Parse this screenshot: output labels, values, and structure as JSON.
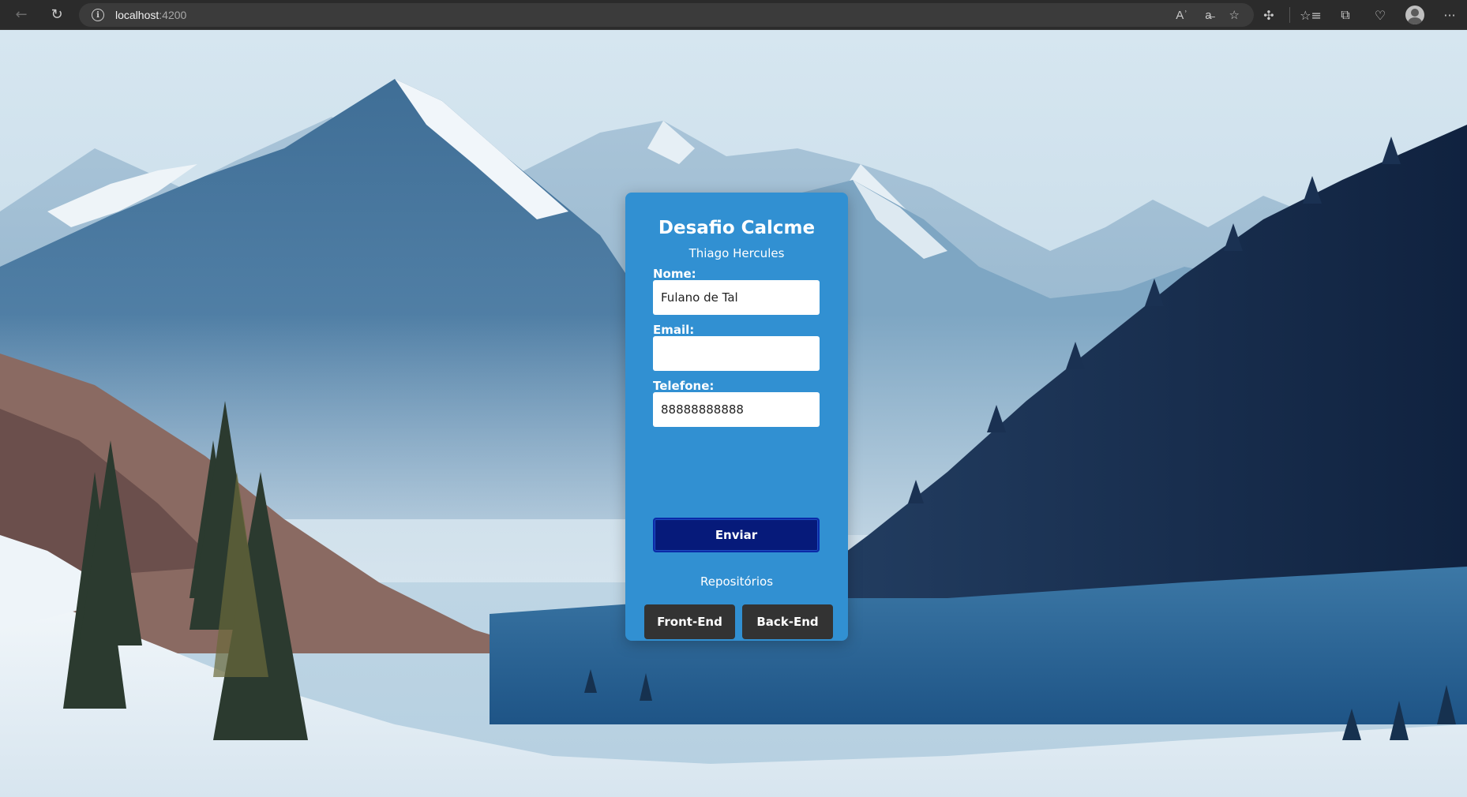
{
  "browser": {
    "url_host": "localhost",
    "url_port": ":4200",
    "icons": [
      "back-icon",
      "refresh-icon",
      "info-icon",
      "read-aloud-icon",
      "translate-icon",
      "favorite-star-icon",
      "extensions-icon",
      "favorites-icon",
      "collections-icon",
      "browser-essentials-icon",
      "profile-icon",
      "more-icon"
    ],
    "glyphs": {
      "back": "←",
      "refresh": "↻",
      "info": "i",
      "read_aloud": "Aʾ",
      "translate": "a̶",
      "star": "☆",
      "extensions": "✣",
      "favorites": "☆≡",
      "collections": "⧉",
      "essentials": "♡",
      "more": "···"
    }
  },
  "form": {
    "title": "Desafio Calcme",
    "subtitle": "Thiago Hercules",
    "name_label": "Nome:",
    "name_value": "Fulano de Tal",
    "email_label": "Email:",
    "email_value": "",
    "phone_label": "Telefone:",
    "phone_value": "88888888888",
    "submit_label": "Enviar",
    "repos_label": "Repositórios",
    "frontend_label": "Front-End",
    "backend_label": "Back-End"
  },
  "colors": {
    "card": "#3190d2",
    "submit": "#061a7a",
    "repo_buttons": "#333333"
  }
}
